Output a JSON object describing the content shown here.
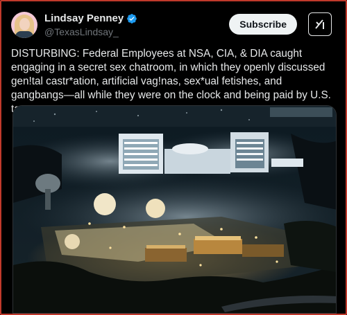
{
  "author": {
    "display_name": "Lindsay Penney",
    "handle": "@TexasLindsay_",
    "verified": true,
    "avatar_icon": "profile-photo"
  },
  "actions": {
    "subscribe_label": "Subscribe",
    "grok_icon": "grok-icon"
  },
  "post": {
    "text": "DISTURBING: Federal Employees at NSA, CIA, & DIA caught engaging in a secret sex chatroom, in which they openly discussed gen!tal castr*ation, artificial vag!nas, sex*ual fetishes, and gangbangs—all while they were on the clock and being paid by U.S. tax payers."
  },
  "media": {
    "alt_icon": "night-aerial-photo-of-government-campus"
  },
  "colors": {
    "background": "#000000",
    "verified_blue": "#1d9bf0",
    "subscribe_bg": "#eff3f4",
    "frame_border": "#c0392b"
  }
}
